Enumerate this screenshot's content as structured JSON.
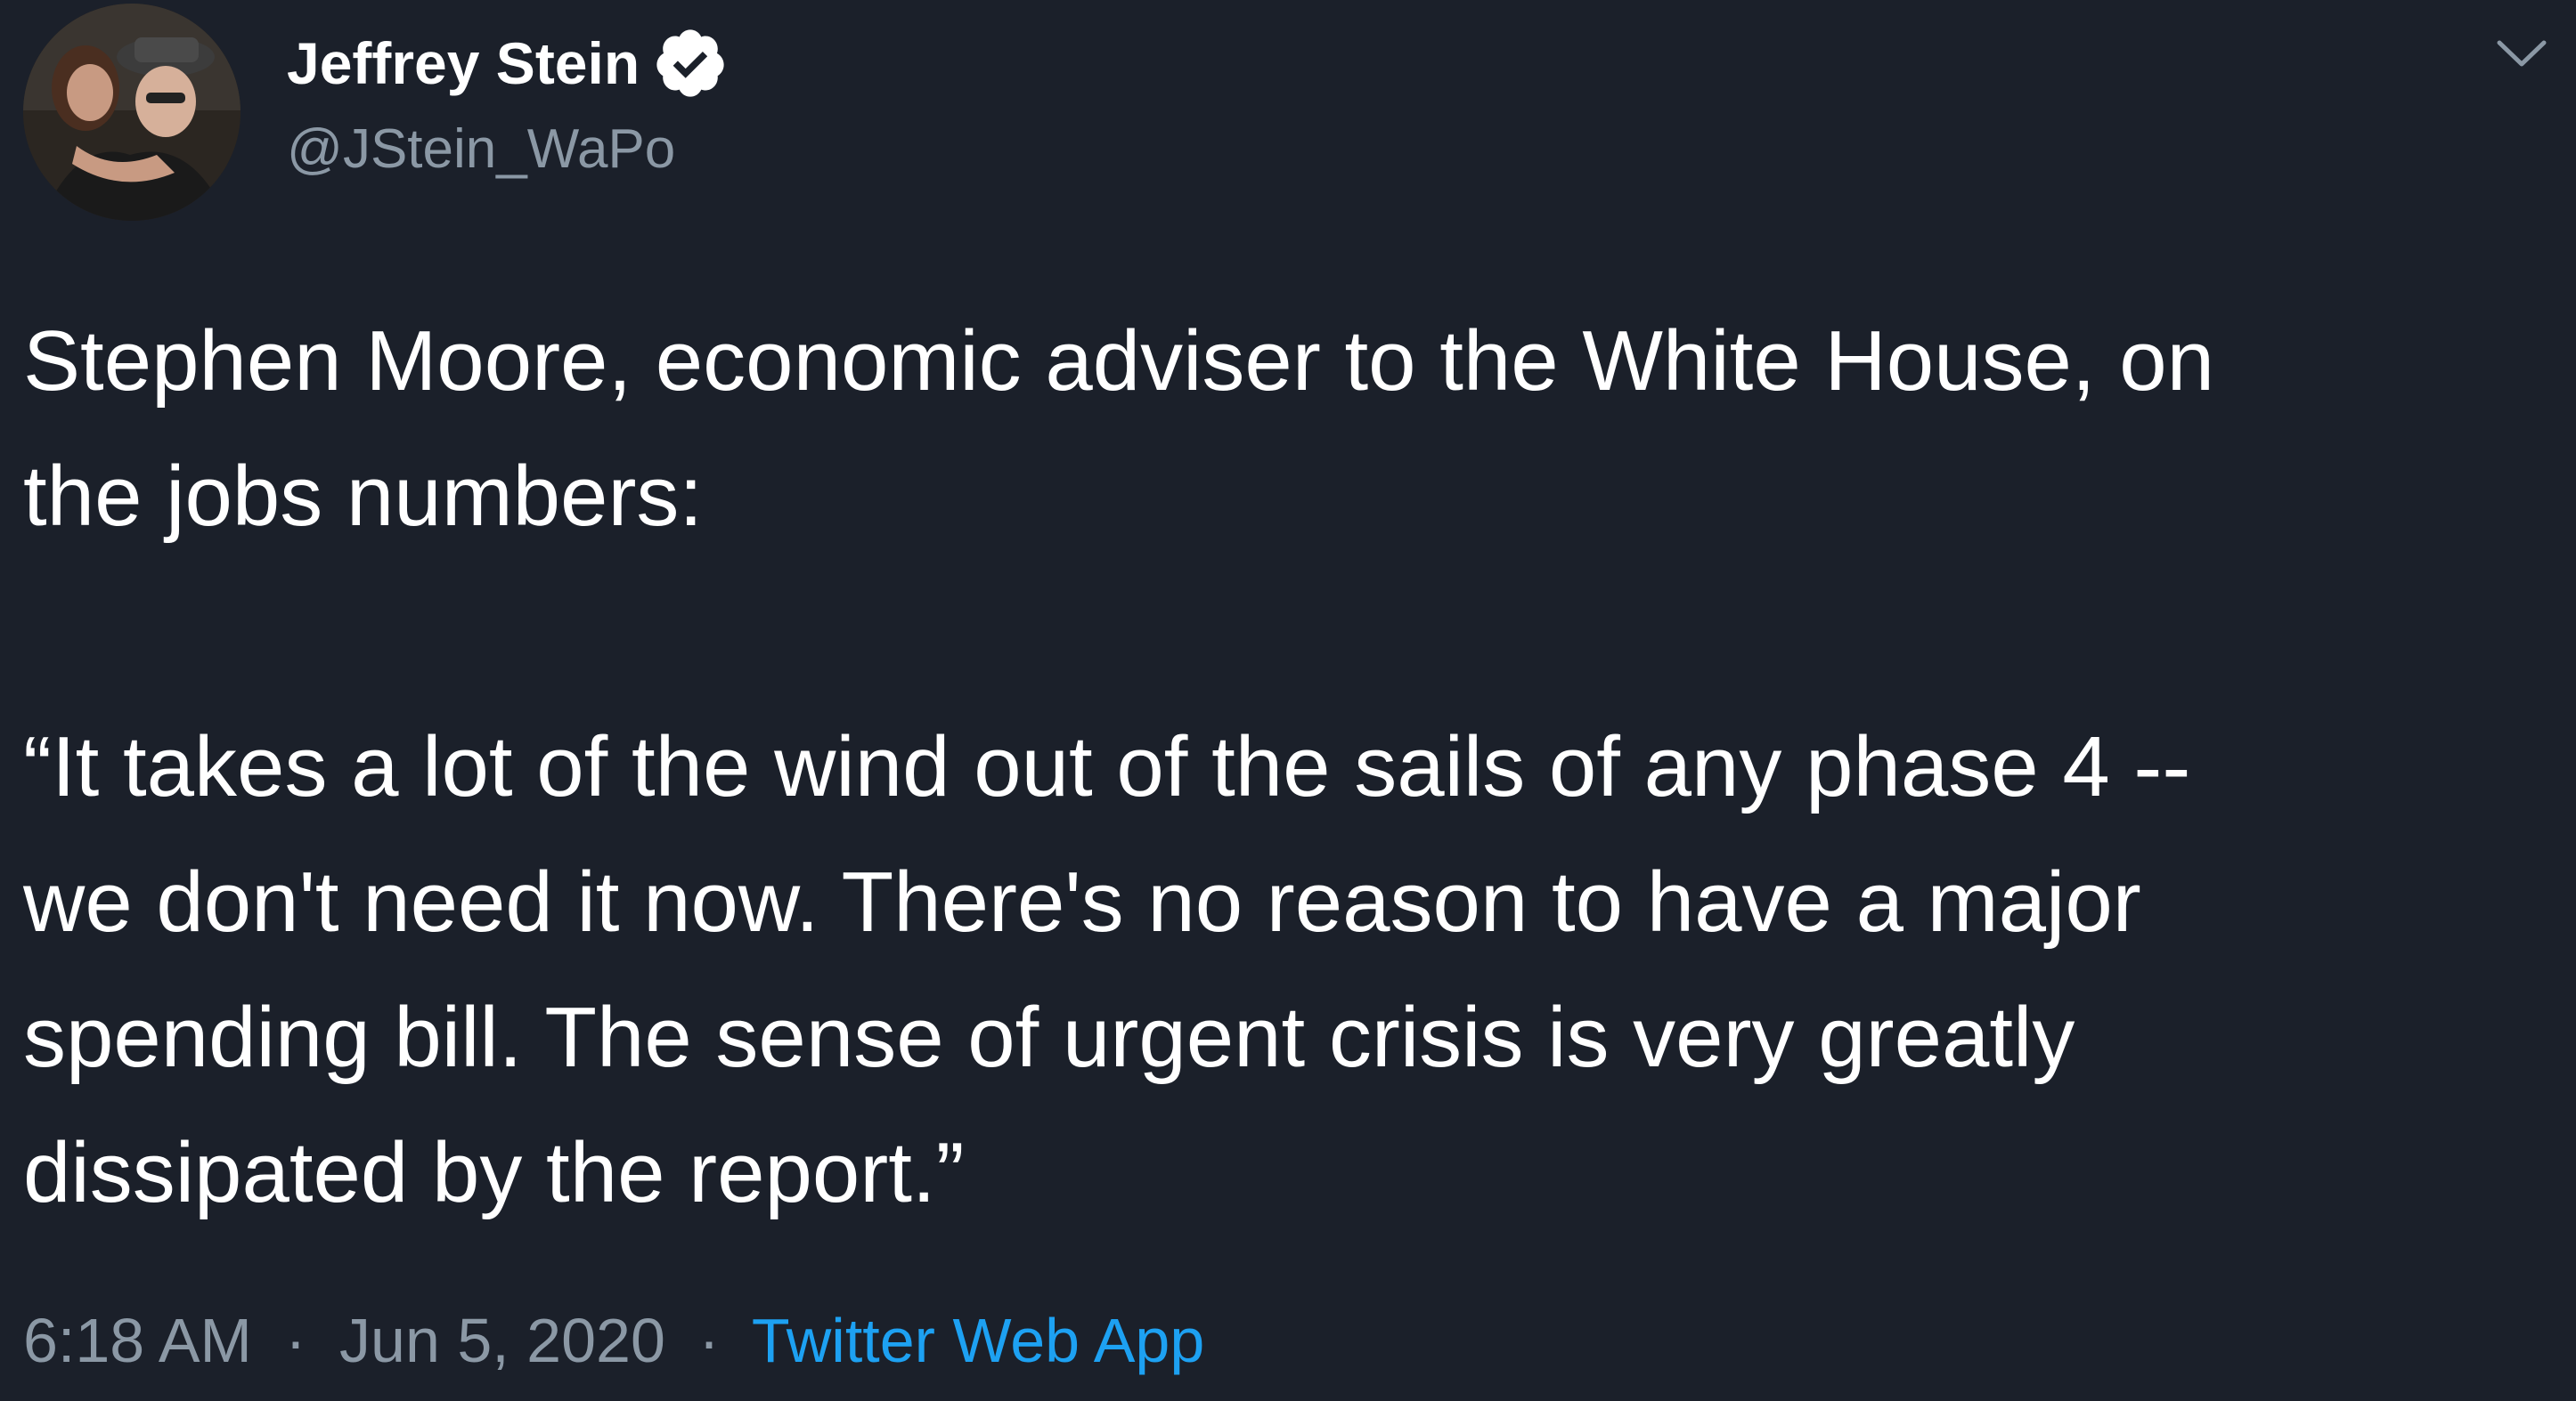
{
  "author": {
    "display_name": "Jeffrey Stein",
    "handle": "@JStein_WaPo",
    "verified": true,
    "avatar_icon": "profile-photo"
  },
  "menu": {
    "icon": "chevron-down-icon"
  },
  "tweet": {
    "paragraph_1": "Stephen Moore, economic adviser to the White House, on\nthe jobs numbers:",
    "paragraph_2": "“It takes a lot of the wind out of the sails of any phase 4 --\nwe don't need it now. There's no reason to have a major\nspending bill. The sense of urgent crisis is very greatly\ndissipated by the report.”"
  },
  "meta": {
    "time": "6:18 AM",
    "separator": "·",
    "date": "Jun 5, 2020",
    "source": "Twitter Web App"
  },
  "colors": {
    "background": "#1b202a",
    "text": "#ffffff",
    "muted": "#8b98a5",
    "link": "#1da1f2"
  }
}
